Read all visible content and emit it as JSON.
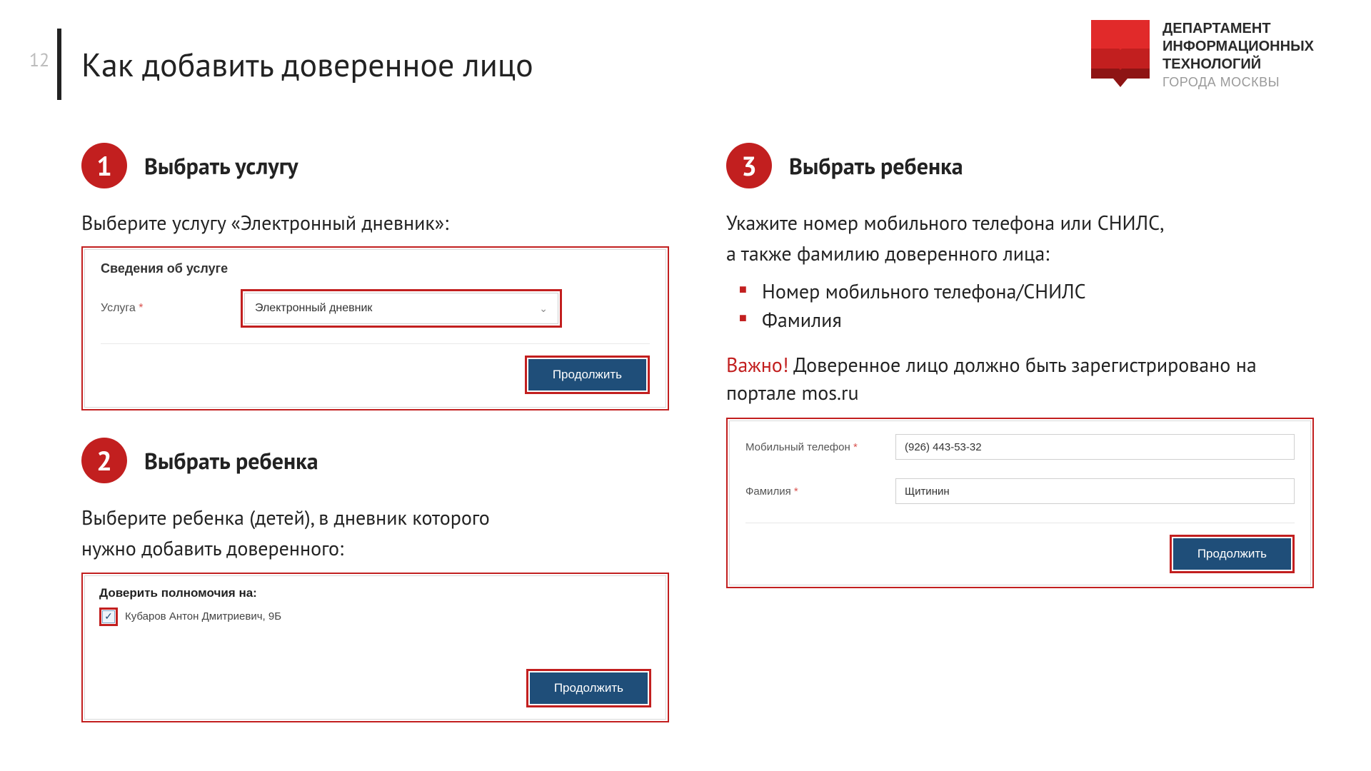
{
  "page_number": "12",
  "title": "Как добавить доверенное лицо",
  "logo": {
    "l1": "ДЕПАРТАМЕНТ",
    "l2": "ИНФОРМАЦИОННЫХ",
    "l3": "ТЕХНОЛОГИЙ",
    "sub": "ГОРОДА МОСКВЫ"
  },
  "step1": {
    "num": "1",
    "title": "Выбрать услугу",
    "desc": "Выберите услугу «Электронный дневник»:",
    "card": {
      "heading": "Сведения об услуге",
      "label": "Услуга",
      "value": "Электронный дневник",
      "button": "Продолжить"
    }
  },
  "step2": {
    "num": "2",
    "title": "Выбрать ребенка",
    "desc_l1": "Выберите ребенка (детей), в дневник которого",
    "desc_l2": "нужно добавить доверенного:",
    "card": {
      "heading": "Доверить полномочия на:",
      "child": "Кубаров Антон Дмитриевич, 9Б",
      "button": "Продолжить"
    }
  },
  "step3": {
    "num": "3",
    "title": "Выбрать ребенка",
    "desc_l1": "Укажите номер мобильного телефона или СНИЛС,",
    "desc_l2": "а также фамилию доверенного лица:",
    "bullet1": "Номер мобильного телефона/СНИЛС",
    "bullet2": "Фамилия",
    "important_prefix": "Важно!",
    "important_text": " Доверенное лицо должно быть зарегистрировано на портале mos.ru",
    "card": {
      "phone_label": "Мобильный телефон",
      "phone_value": "(926) 443-53-32",
      "surname_label": "Фамилия",
      "surname_value": "Щитинин",
      "button": "Продолжить"
    }
  }
}
